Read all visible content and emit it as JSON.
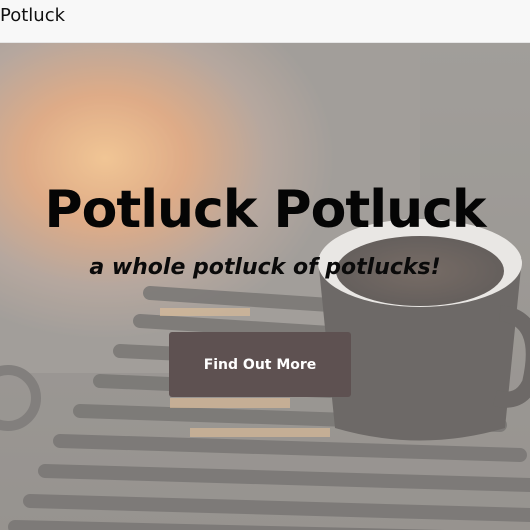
{
  "navbar": {
    "brand": "Potluck"
  },
  "hero": {
    "title": "Potluck Potluck",
    "subtitle": "a whole potluck of potlucks!",
    "cta_label": "Find Out More",
    "cta_color": "#5e5151"
  }
}
